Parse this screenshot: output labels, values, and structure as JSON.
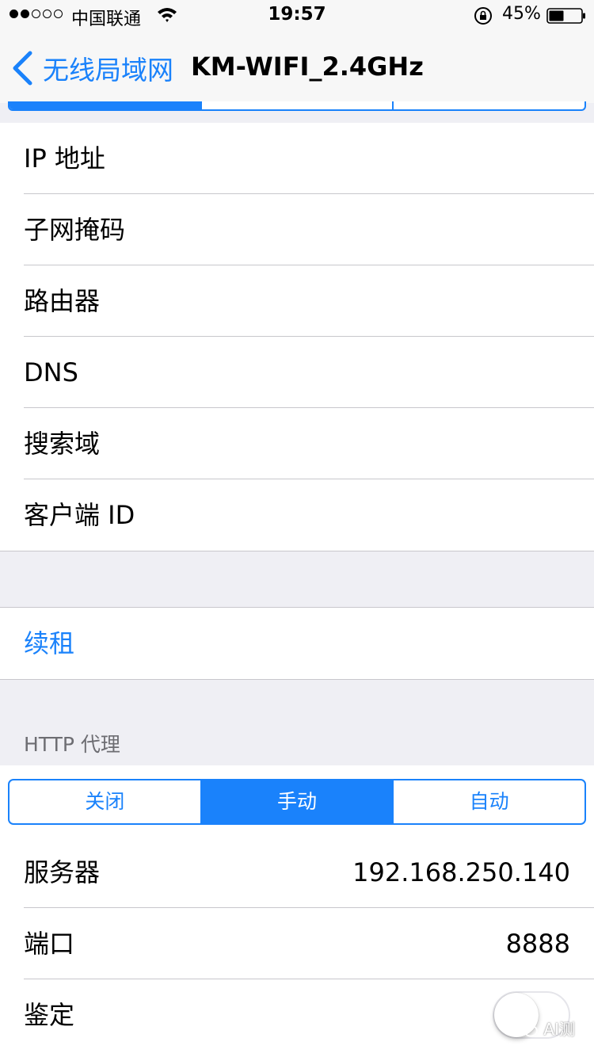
{
  "status_bar": {
    "carrier": "中国联通",
    "time": "19:57",
    "battery": "45%",
    "signal_dots": [
      true,
      true,
      false,
      false,
      false
    ]
  },
  "nav": {
    "back_label": "无线局域网",
    "title": "KM-WIFI_2.4GHz"
  },
  "top_segment": {
    "selected_index": 0
  },
  "info_rows": [
    {
      "label": "IP 地址"
    },
    {
      "label": "子网掩码"
    },
    {
      "label": "路由器"
    },
    {
      "label": "DNS"
    },
    {
      "label": "搜索域"
    },
    {
      "label": "客户端 ID"
    }
  ],
  "renew": {
    "label": "续租"
  },
  "http_proxy": {
    "header": "HTTP 代理",
    "segments": [
      "关闭",
      "手动",
      "自动"
    ],
    "selected_index": 1,
    "server": {
      "label": "服务器",
      "value": "192.168.250.140"
    },
    "port": {
      "label": "端口",
      "value": "8888"
    },
    "auth": {
      "label": "鉴定",
      "enabled": false
    }
  },
  "watermark": {
    "text": "AI测"
  },
  "colors": {
    "accent": "#1a82fb",
    "background": "#efeff4",
    "separator": "#c8c7cc"
  }
}
